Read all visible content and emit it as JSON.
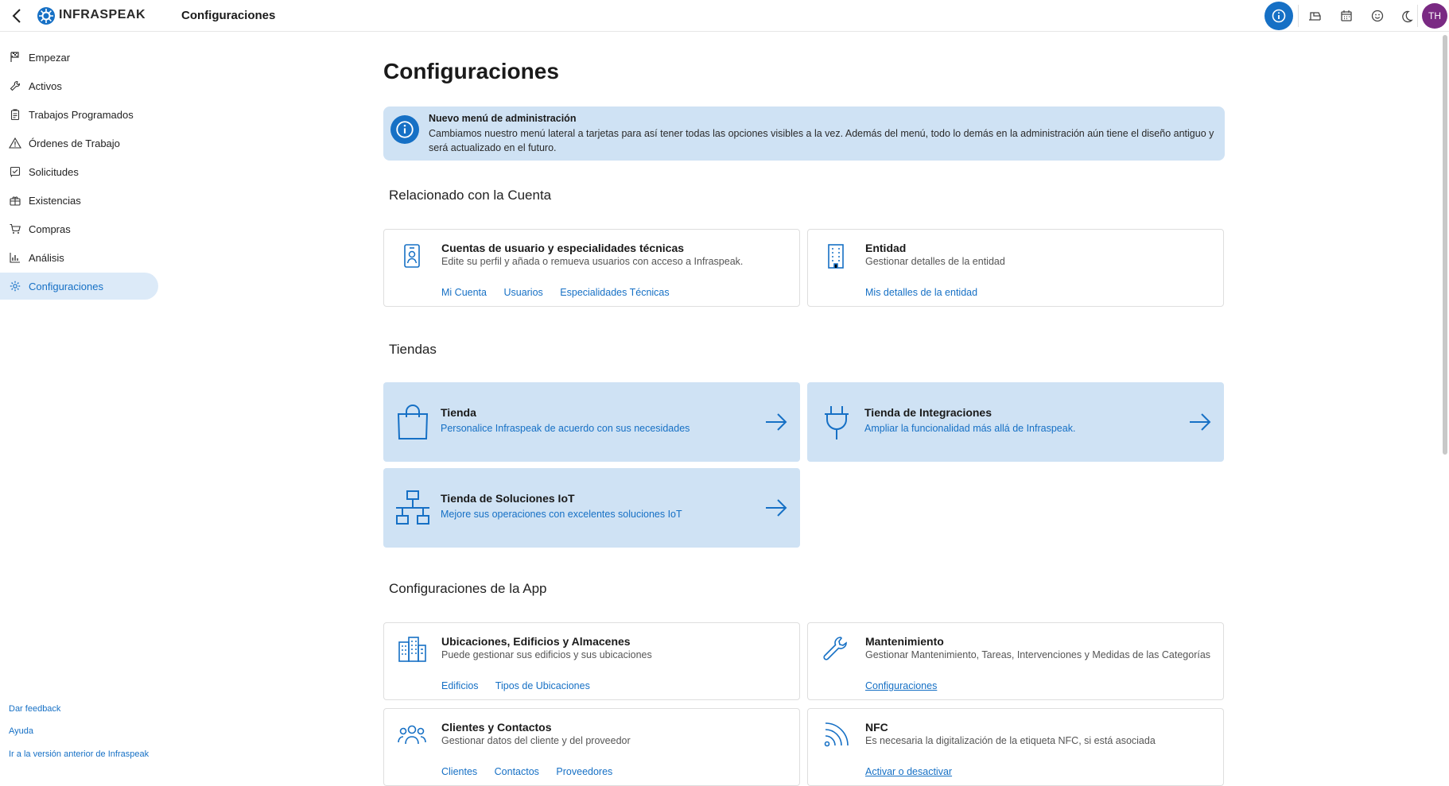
{
  "header": {
    "brand": "INFRASPEAK",
    "title": "Configuraciones",
    "avatar_initials": "TH",
    "accent_color": "#1670c5",
    "avatar_color": "#7a2a83"
  },
  "sidebar": {
    "items": [
      {
        "label": "Empezar",
        "icon": "flag-checkered-icon"
      },
      {
        "label": "Activos",
        "icon": "wrench-icon"
      },
      {
        "label": "Trabajos Programados",
        "icon": "clipboard-icon"
      },
      {
        "label": "Órdenes de Trabajo",
        "icon": "warning-icon"
      },
      {
        "label": "Solicitudes",
        "icon": "request-icon"
      },
      {
        "label": "Existencias",
        "icon": "boxes-icon"
      },
      {
        "label": "Compras",
        "icon": "cart-icon"
      },
      {
        "label": "Análisis",
        "icon": "chart-icon"
      },
      {
        "label": "Configuraciones",
        "icon": "gear-icon"
      }
    ],
    "footer_links": [
      "Dar feedback",
      "Ayuda",
      "Ir a la versión anterior de Infraspeak"
    ]
  },
  "main": {
    "title": "Configuraciones",
    "banner": {
      "title": "Nuevo menú de administración",
      "text": "Cambiamos nuestro menú lateral a tarjetas para así tener todas las opciones visibles a la vez. Además del menú, todo lo demás en la administración aún tiene el diseño antiguo y será actualizado en el futuro."
    },
    "sections": {
      "account": "Relacionado con la Cuenta",
      "stores": "Tiendas",
      "app": "Configuraciones de la App"
    },
    "account_cards": [
      {
        "title": "Cuentas de usuario y especialidades técnicas",
        "desc": "Edite su perfil y añada o remueva usuarios con acceso a Infraspeak.",
        "links": [
          "Mi Cuenta",
          "Usuarios",
          "Especialidades Técnicas"
        ]
      },
      {
        "title": "Entidad",
        "desc": "Gestionar detalles de la entidad",
        "links": [
          "Mis detalles de la entidad"
        ]
      }
    ],
    "store_cards": [
      {
        "title": "Tienda",
        "desc": "Personalice Infraspeak de acuerdo con sus necesidades"
      },
      {
        "title": "Tienda de Integraciones",
        "desc": "Ampliar la funcionalidad más allá de Infraspeak."
      },
      {
        "title": "Tienda de Soluciones IoT",
        "desc": "Mejore sus operaciones con excelentes soluciones IoT"
      }
    ],
    "app_cards": [
      {
        "title": "Ubicaciones, Edificios y Almacenes",
        "desc": "Puede gestionar sus edificios y sus ubicaciones",
        "links": [
          "Edificios",
          "Tipos de Ubicaciones"
        ]
      },
      {
        "title": "Mantenimiento",
        "desc": "Gestionar Mantenimiento, Tareas, Intervenciones y Medidas de las Categorías",
        "links": [
          "Configuraciones"
        ]
      },
      {
        "title": "Clientes y Contactos",
        "desc": "Gestionar datos del cliente y del proveedor",
        "links": [
          "Clientes",
          "Contactos",
          "Proveedores"
        ]
      },
      {
        "title": "NFC",
        "desc": "Es necesaria la digitalización de la etiqueta NFC, si está asociada",
        "links": [
          "Activar o desactivar"
        ]
      }
    ]
  }
}
